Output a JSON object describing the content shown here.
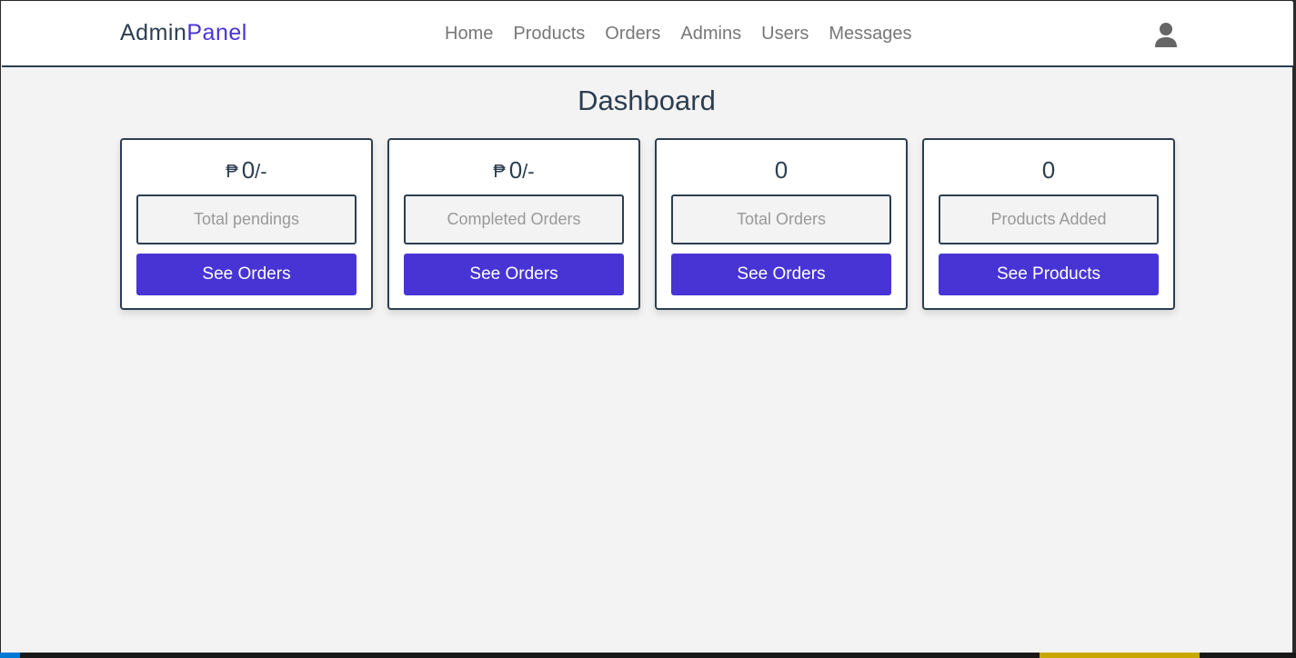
{
  "brand": {
    "part1": "Admin",
    "part2": "Panel"
  },
  "nav": {
    "items": [
      {
        "label": "Home"
      },
      {
        "label": "Products"
      },
      {
        "label": "Orders"
      },
      {
        "label": "Admins"
      },
      {
        "label": "Users"
      },
      {
        "label": "Messages"
      }
    ]
  },
  "page": {
    "title": "Dashboard"
  },
  "cards": [
    {
      "currency": "₱",
      "value": "0",
      "suffix": "/-",
      "label": "Total pendings",
      "button": "See Orders"
    },
    {
      "currency": "₱",
      "value": "0",
      "suffix": "/-",
      "label": "Completed Orders",
      "button": "See Orders"
    },
    {
      "currency": "",
      "value": "0",
      "suffix": "",
      "label": "Total Orders",
      "button": "See Orders"
    },
    {
      "currency": "",
      "value": "0",
      "suffix": "",
      "label": "Products Added",
      "button": "See Products"
    }
  ],
  "icons": {
    "user": "user-icon"
  },
  "colors": {
    "accent": "#4834d4",
    "dark": "#2c3e50",
    "background": "#f3f3f3"
  }
}
